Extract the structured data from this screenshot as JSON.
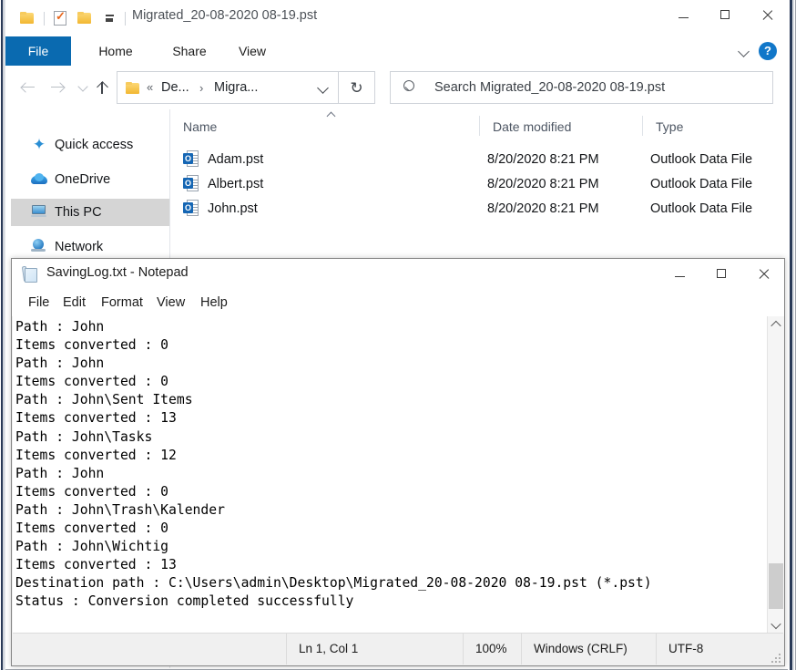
{
  "explorer": {
    "title": "Migrated_20-08-2020 08-19.pst",
    "quick_access_toolbar": [
      {
        "icon": "folder-icon",
        "name": "restore-down-folder"
      },
      {
        "icon": "properties-icon",
        "name": "properties"
      },
      {
        "icon": "folder-icon",
        "name": "new-folder"
      },
      {
        "icon": "customize-dropdown-icon",
        "name": "customize-quick-access-toolbar"
      }
    ],
    "window_buttons": {
      "minimize": "minimize-icon",
      "maximize": "maximize-icon",
      "close": "close-icon"
    },
    "ribbon": {
      "tabs": [
        {
          "label": "File",
          "active": true
        },
        {
          "label": "Home",
          "active": false
        },
        {
          "label": "Share",
          "active": false
        },
        {
          "label": "View",
          "active": false
        }
      ],
      "collapse_icon": "chevron-down-icon",
      "help_label": "?"
    },
    "navbar": {
      "back_icon": "arrow-left-icon",
      "forward_icon": "arrow-right-icon",
      "recent_icon": "chevron-down-icon",
      "up_icon": "arrow-up-icon",
      "breadcrumb": {
        "overflow": "«",
        "parts": [
          "De...",
          "Migra..."
        ],
        "separator": "›",
        "dropdown_icon": "chevron-down-icon"
      },
      "refresh_icon": "↻",
      "refresh_name": "refresh-button",
      "search_placeholder": "Search Migrated_20-08-2020 08-19.pst",
      "search_value": ""
    },
    "nav_pane": {
      "items": [
        {
          "label": "Quick access",
          "icon": "star-icon",
          "selected": false
        },
        {
          "label": "OneDrive",
          "icon": "cloud-icon",
          "selected": false
        },
        {
          "label": "This PC",
          "icon": "monitor-icon",
          "selected": true
        },
        {
          "label": "Network",
          "icon": "network-globe-icon",
          "selected": false
        }
      ]
    },
    "file_list": {
      "columns": [
        {
          "label": "Name",
          "sorted": "ascending"
        },
        {
          "label": "Date modified",
          "sorted": ""
        },
        {
          "label": "Type",
          "sorted": ""
        }
      ],
      "rows": [
        {
          "name": "Adam.pst",
          "date": "8/20/2020 8:21 PM",
          "type": "Outlook Data File",
          "icon": "outlook-pst-icon"
        },
        {
          "name": "Albert.pst",
          "date": "8/20/2020 8:21 PM",
          "type": "Outlook Data File",
          "icon": "outlook-pst-icon"
        },
        {
          "name": "John.pst",
          "date": "8/20/2020 8:21 PM",
          "type": "Outlook Data File",
          "icon": "outlook-pst-icon"
        }
      ]
    }
  },
  "notepad": {
    "title": "SavingLog.txt - Notepad",
    "app_icon": "notepad-icon",
    "window_buttons": {
      "minimize": "minimize-icon",
      "maximize": "maximize-icon",
      "close": "close-icon"
    },
    "menus": [
      "File",
      "Edit",
      "Format",
      "View",
      "Help"
    ],
    "content": "Path : John\nItems converted : 0\nPath : John\nItems converted : 0\nPath : John\\Sent Items\nItems converted : 13\nPath : John\\Tasks\nItems converted : 12\nPath : John\nItems converted : 0\nPath : John\\Trash\\Kalender\nItems converted : 0\nPath : John\\Wichtig\nItems converted : 13\nDestination path : C:\\Users\\admin\\Desktop\\Migrated_20-08-2020 08-19.pst (*.pst)\nStatus : Conversion completed successfully",
    "scrollbar": {
      "up_icon": "chevron-up-icon",
      "down_icon": "chevron-down-icon"
    },
    "statusbar": {
      "cursor": "Ln 1, Col 1",
      "zoom": "100%",
      "line_ending": "Windows (CRLF)",
      "encoding": "UTF-8"
    }
  },
  "colors": {
    "ribbon_file_tab": "#0a6ab0",
    "help_badge": "#1177c9",
    "selection": "#d5d5d5",
    "scroll_thumb": "#cdcdcd"
  }
}
